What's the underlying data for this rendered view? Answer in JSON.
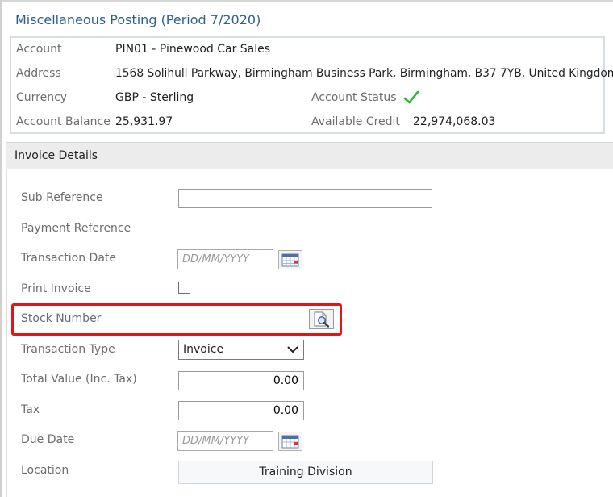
{
  "page": {
    "title": "Miscellaneous Posting (Period 7/2020)"
  },
  "account": {
    "account_label": "Account",
    "account_value": "PIN01 - Pinewood Car Sales",
    "address_label": "Address",
    "address_value": "1568 Solihull Parkway, Birmingham Business Park, Birmingham, B37 7YB, United Kingdom",
    "currency_label": "Currency",
    "currency_value": "GBP - Sterling",
    "status_label": "Account Status",
    "status_icon": "checkmark-icon",
    "status_color": "#2db82d",
    "balance_label": "Account Balance",
    "balance_value": "25,931.97",
    "credit_label": "Available Credit",
    "credit_value": "22,974,068.03"
  },
  "invoice": {
    "section_title": "Invoice Details",
    "sub_reference_label": "Sub Reference",
    "sub_reference_value": "",
    "payment_reference_label": "Payment Reference",
    "transaction_date_label": "Transaction Date",
    "transaction_date_placeholder": "DD/MM/YYYY",
    "print_invoice_label": "Print Invoice",
    "print_invoice_checked": false,
    "stock_number_label": "Stock Number",
    "transaction_type_label": "Transaction Type",
    "transaction_type_value": "Invoice",
    "total_value_label": "Total Value (Inc. Tax)",
    "total_value": "0.00",
    "tax_label": "Tax",
    "tax_value": "0.00",
    "due_date_label": "Due Date",
    "due_date_placeholder": "DD/MM/YYYY",
    "location_label": "Location",
    "location_value": "Training Division"
  },
  "colors": {
    "title": "#2f5f8f",
    "highlight": "#e01515"
  }
}
